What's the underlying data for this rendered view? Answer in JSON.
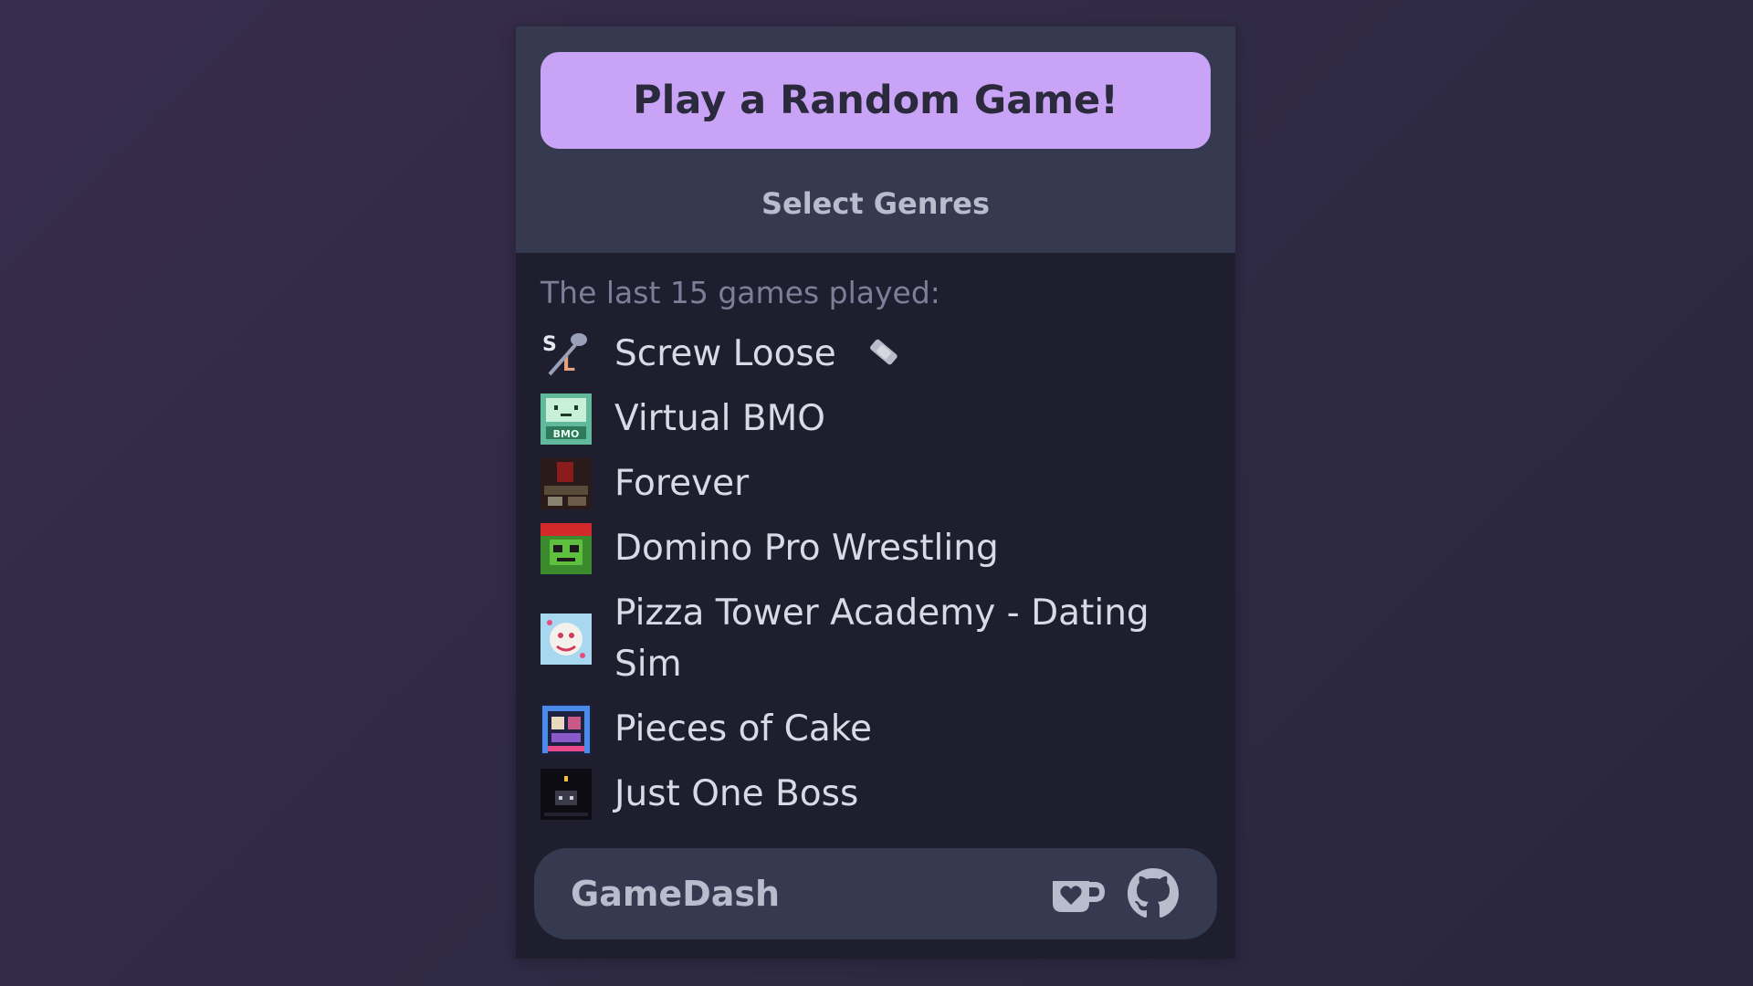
{
  "random_button": {
    "label": "Play a Random Game!"
  },
  "genres_link": {
    "label": "Select Genres"
  },
  "recent": {
    "heading": "The last 15 games played:",
    "games": [
      {
        "title": "Screw Loose",
        "icon": "screw-loose-thumbnail",
        "badge_icon": "wrench-badge-icon"
      },
      {
        "title": "Virtual BMO",
        "icon": "virtual-bmo-thumbnail"
      },
      {
        "title": "Forever",
        "icon": "forever-thumbnail"
      },
      {
        "title": "Domino Pro Wrestling",
        "icon": "domino-pro-wrestling-thumbnail"
      },
      {
        "title": "Pizza Tower Academy - Dating Sim",
        "icon": "pizza-tower-academy-thumbnail"
      },
      {
        "title": "Pieces of Cake",
        "icon": "pieces-of-cake-thumbnail"
      },
      {
        "title": "Just One Boss",
        "icon": "just-one-boss-thumbnail"
      }
    ]
  },
  "footer": {
    "name": "GameDash",
    "icons": [
      "kofi-cup-icon",
      "github-icon"
    ]
  },
  "colors": {
    "background": "#2e2a44",
    "popup": "#1f1e2e",
    "panel": "#363a50",
    "accent": "#c8a3f6",
    "text": "#d8dae6",
    "muted": "#7c7f98"
  }
}
